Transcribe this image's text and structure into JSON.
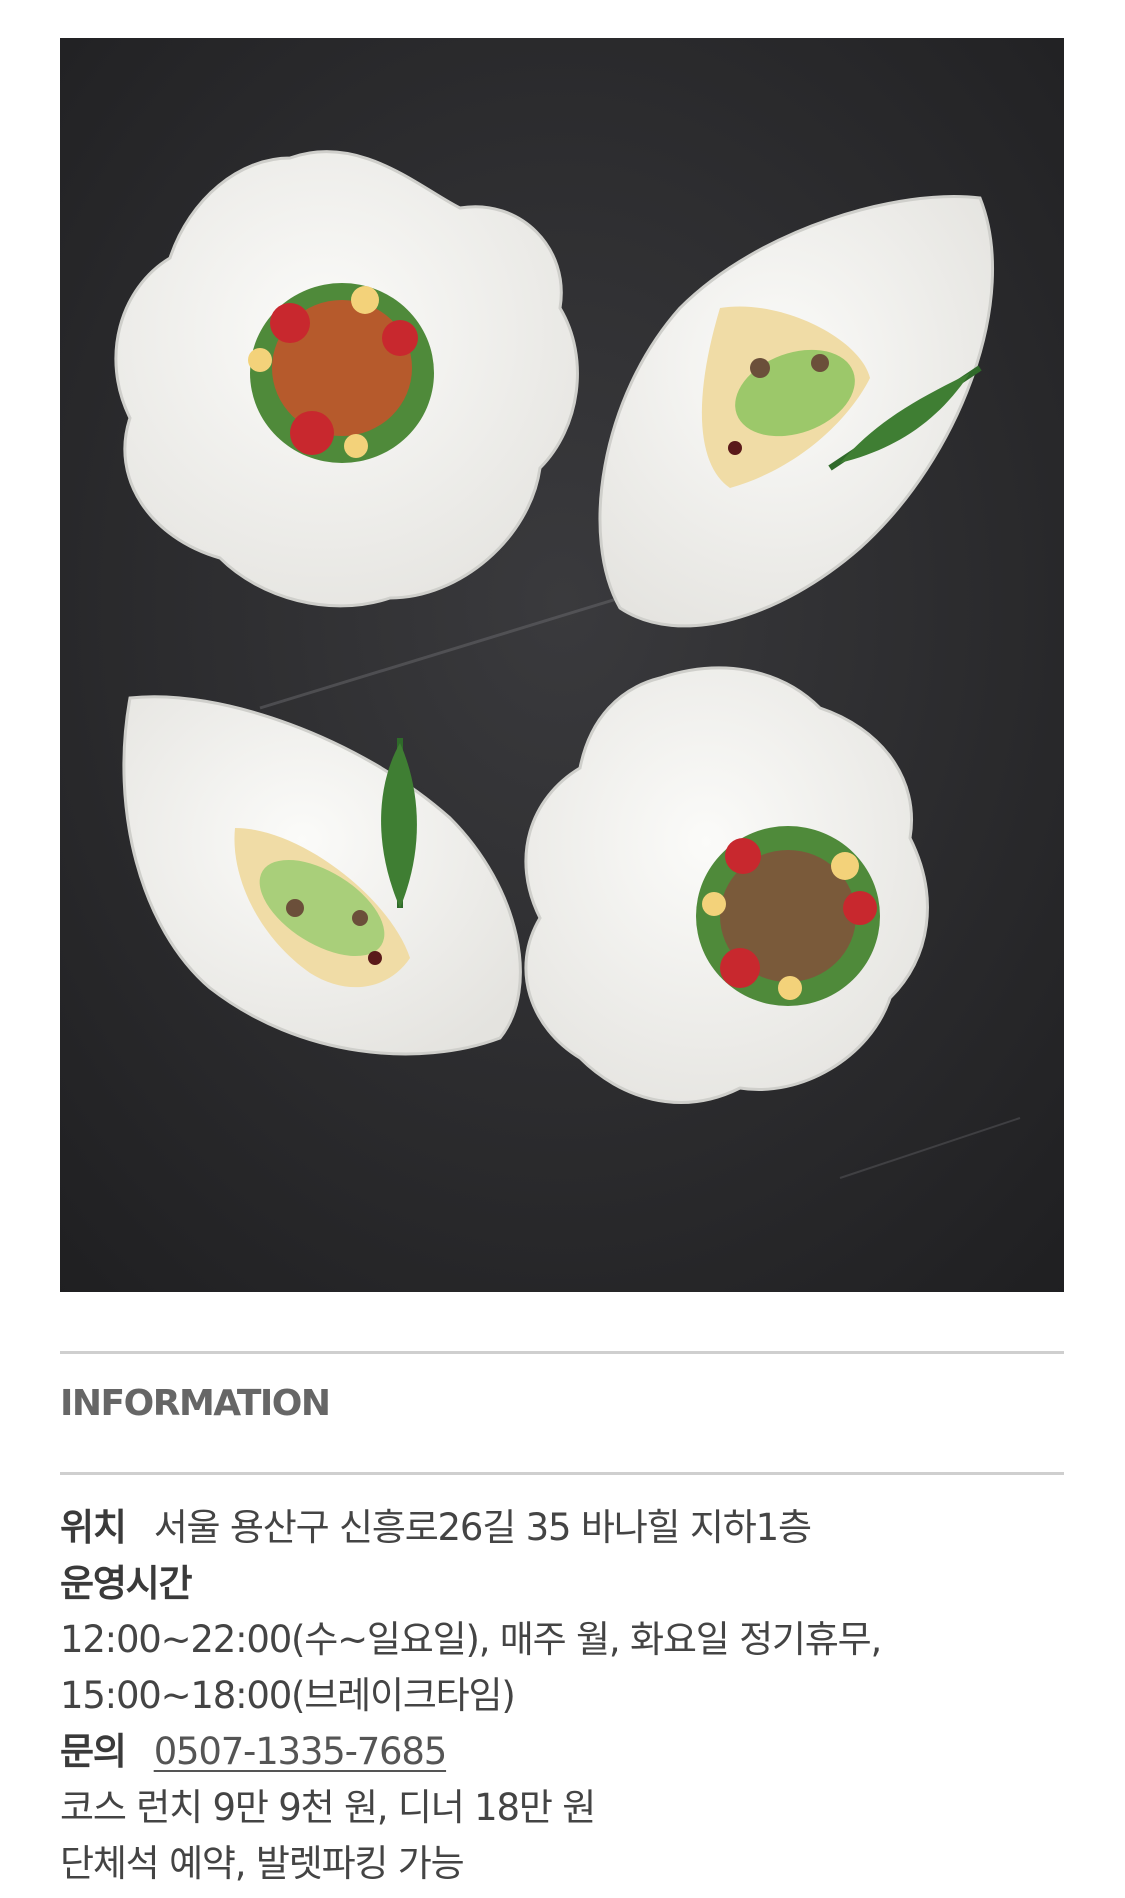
{
  "photo": {
    "description_icon": "food-plating-photo",
    "colors": {
      "background": "#2a2a2c",
      "plate": "#f3f2ef"
    }
  },
  "section": {
    "title": "INFORMATION"
  },
  "info": {
    "location_label": "위치",
    "location_value": "서울 용산구 신흥로26길 35 바나힐 지하1층",
    "hours_label": "운영시간",
    "hours_line1": "12:00~22:00(수~일요일), 매주 월, 화요일 정기휴무,",
    "hours_line2": "15:00~18:00(브레이크타임)",
    "contact_label": "문의",
    "contact_phone": "0507-1335-7685",
    "price_line": "코스 런치 9만 9천 원, 디너 18만 원",
    "notes_line": "단체석 예약, 발렛파킹 가능"
  }
}
